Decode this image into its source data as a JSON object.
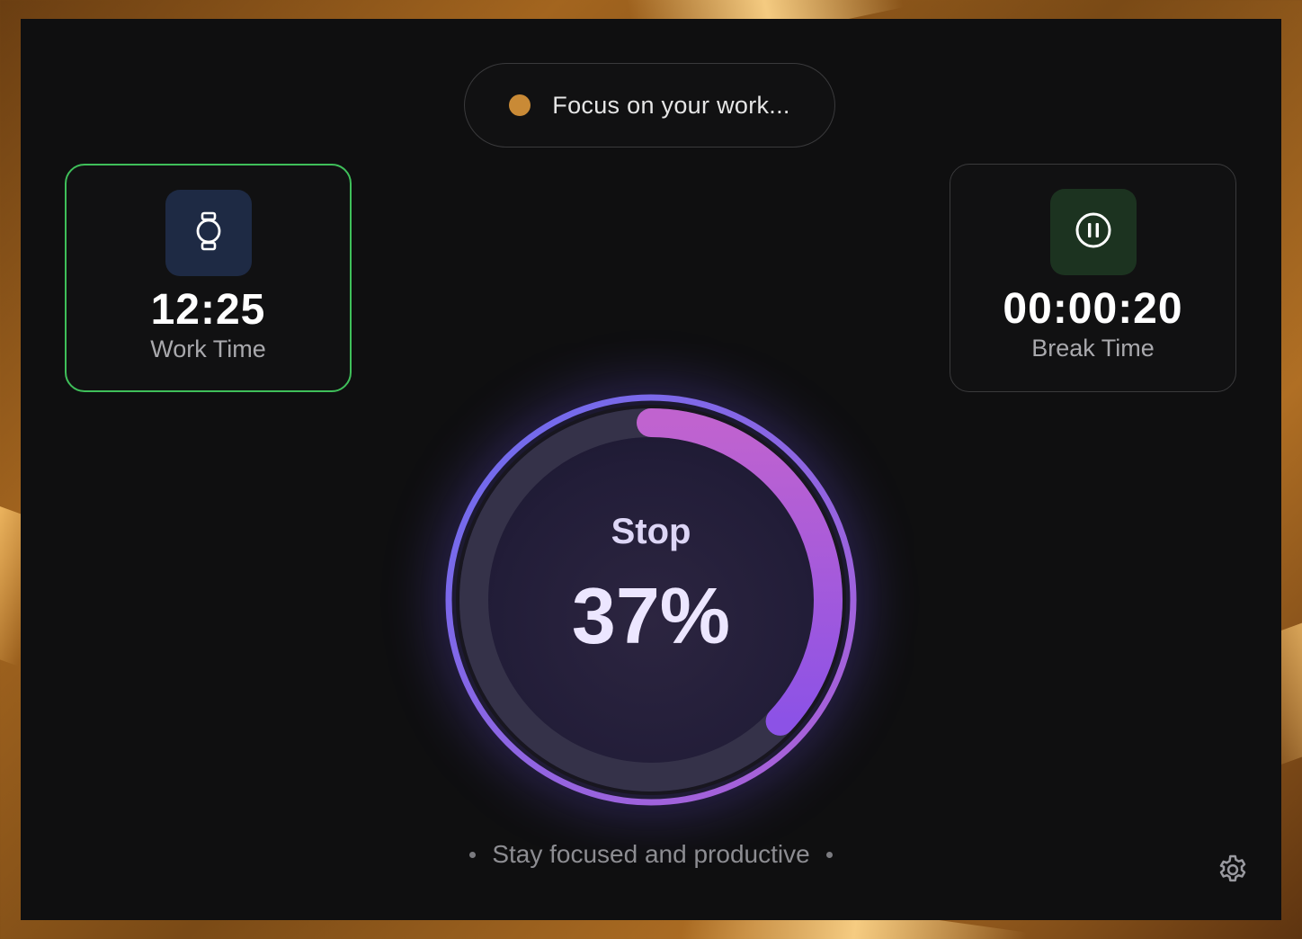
{
  "status": {
    "text": "Focus on your work...",
    "dot_color": "#c98a36"
  },
  "work_card": {
    "icon": "watch-icon",
    "value": "12:25",
    "label": "Work Time",
    "active": true,
    "border_color": "#3fbf5a"
  },
  "break_card": {
    "icon": "pause-circle-icon",
    "value": "00:00:20",
    "label": "Break Time",
    "active": false
  },
  "progress": {
    "action_label": "Stop",
    "percent_text": "37%",
    "value": 0.37,
    "gradient_start": "#6a6cf0",
    "gradient_end": "#c062d0"
  },
  "tagline": {
    "text": "Stay focused and productive"
  },
  "settings": {
    "icon": "gear-icon"
  }
}
